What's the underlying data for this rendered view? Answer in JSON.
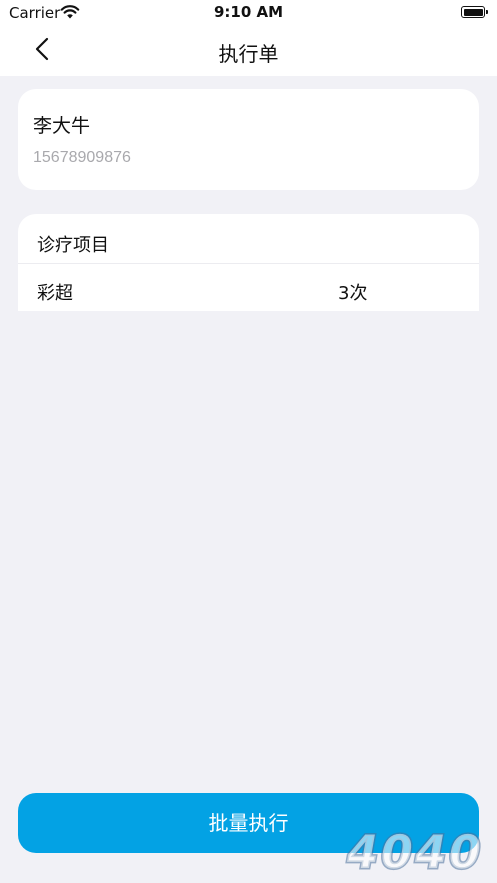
{
  "status_bar": {
    "carrier": "Carrier",
    "time": "9:10 AM"
  },
  "nav": {
    "title": "执行单",
    "back_icon": "chevron-left-icon"
  },
  "patient": {
    "name": "李大牛",
    "phone": "15678909876"
  },
  "items_section": {
    "title": "诊疗项目",
    "rows": [
      {
        "name": "彩超",
        "count": "3次"
      }
    ]
  },
  "action": {
    "label": "批量执行"
  },
  "watermark": {
    "text": "4040"
  },
  "colors": {
    "accent": "#03a2e4",
    "background": "#f1f1f6",
    "card": "#ffffff",
    "phone_text": "#a9a9ad"
  }
}
